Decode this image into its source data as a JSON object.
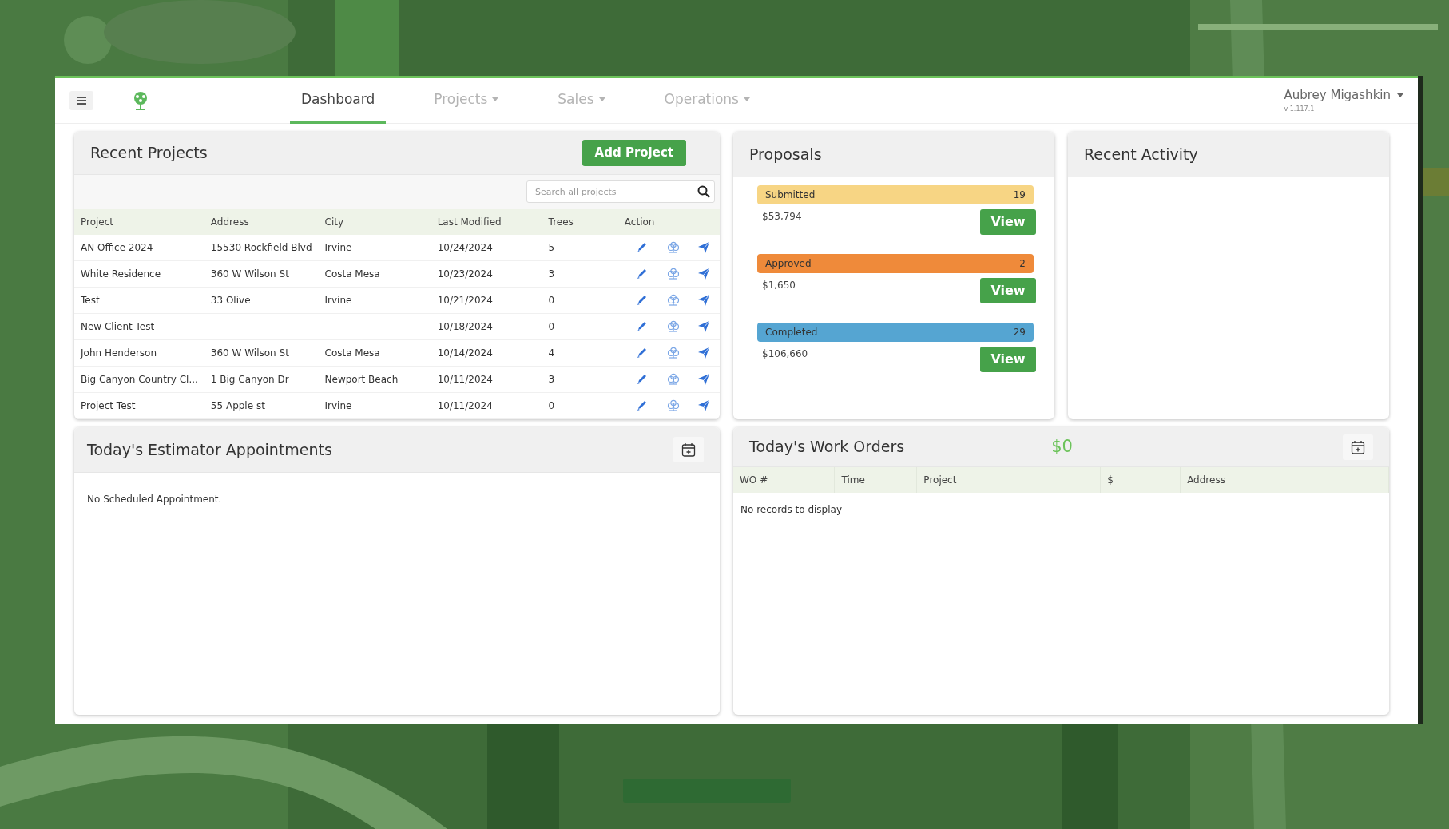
{
  "nav": {
    "tabs": [
      {
        "label": "Dashboard",
        "selected": true,
        "dropdown": false
      },
      {
        "label": "Projects",
        "selected": false,
        "dropdown": true
      },
      {
        "label": "Sales",
        "selected": false,
        "dropdown": true
      },
      {
        "label": "Operations",
        "selected": false,
        "dropdown": true
      }
    ],
    "user": "Aubrey Migashkin",
    "version": "v 1.117.1"
  },
  "recent_projects": {
    "title": "Recent Projects",
    "add_button": "Add Project",
    "search_placeholder": "Search all projects",
    "columns": [
      "Project",
      "Address",
      "City",
      "Last Modified",
      "Trees",
      "Action"
    ],
    "rows": [
      {
        "cells": [
          "AN Office 2024",
          "15530 Rockfield Blvd",
          "Irvine",
          "10/24/2024",
          "5"
        ]
      },
      {
        "cells": [
          "White Residence",
          "360 W Wilson St",
          "Costa Mesa",
          "10/23/2024",
          "3"
        ]
      },
      {
        "cells": [
          "Test",
          "33 Olive",
          "Irvine",
          "10/21/2024",
          "0"
        ]
      },
      {
        "cells": [
          "New Client Test",
          "",
          "",
          "10/18/2024",
          "0"
        ]
      },
      {
        "cells": [
          "John Henderson",
          "360 W Wilson St",
          "Costa Mesa",
          "10/14/2024",
          "4"
        ]
      },
      {
        "cells": [
          "Big Canyon Country Cl...",
          "1 Big Canyon Dr",
          "Newport Beach",
          "10/11/2024",
          "3"
        ]
      },
      {
        "cells": [
          "Project Test",
          "55 Apple st",
          "Irvine",
          "10/11/2024",
          "0"
        ]
      }
    ]
  },
  "proposals": {
    "title": "Proposals",
    "groups": [
      {
        "label": "Submitted",
        "count": "19",
        "amount": "$53,794",
        "button": "View",
        "color": "#f7d584"
      },
      {
        "label": "Approved",
        "count": "2",
        "amount": "$1,650",
        "button": "View",
        "color": "#ef8a3a"
      },
      {
        "label": "Completed",
        "count": "29",
        "amount": "$106,660",
        "button": "View",
        "color": "#55a5d2"
      }
    ]
  },
  "recent_activity": {
    "title": "Recent Activity"
  },
  "appointments": {
    "title": "Today's Estimator Appointments",
    "empty_text": "No Scheduled Appointment."
  },
  "work_orders": {
    "title": "Today's Work Orders",
    "total": "$0",
    "columns": [
      "WO #",
      "Time",
      "Project",
      "$",
      "Address"
    ],
    "empty_text": "No records to display"
  }
}
